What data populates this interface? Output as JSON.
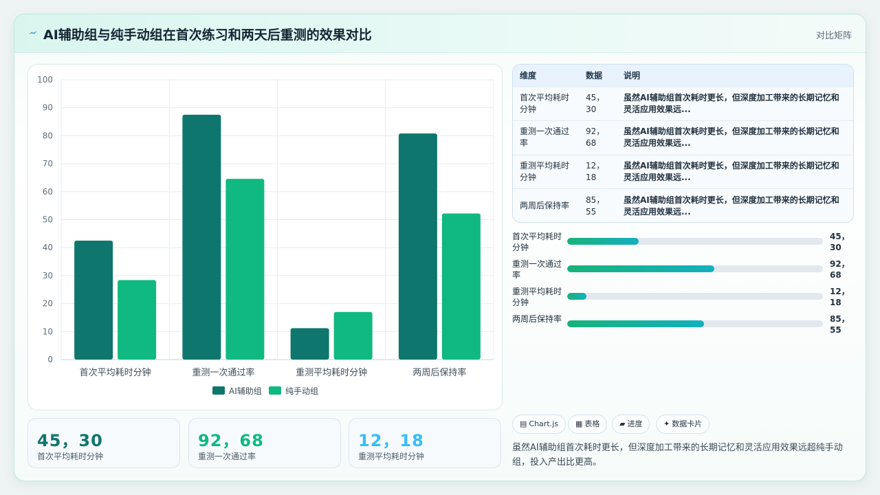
{
  "header": {
    "icon": "lightning-icon",
    "title": "AI辅助组与纯手动组在首次练习和两天后重测的效果对比",
    "badge": "对比矩阵"
  },
  "chart_data": {
    "type": "bar",
    "categories": [
      "首次平均耗时分钟",
      "重测一次通过率",
      "重测平均耗时分钟",
      "两周后保持率"
    ],
    "series": [
      {
        "name": "AI辅助组",
        "values": [
          42.5,
          87.5,
          11.2,
          80.8
        ],
        "color": "#0f766e"
      },
      {
        "name": "纯手动组",
        "values": [
          28.4,
          64.6,
          17.0,
          52.2
        ],
        "color": "#10b981"
      }
    ],
    "ylim": [
      0,
      100
    ],
    "yticks": [
      0,
      10,
      20,
      30,
      40,
      50,
      60,
      70,
      80,
      90,
      100
    ],
    "legend_position": "bottom",
    "grid": true
  },
  "table": {
    "headers": [
      "维度",
      "数据",
      "说明"
    ],
    "rows": [
      {
        "dim": "首次平均耗时分钟",
        "data": "45，30",
        "desc": "虽然AI辅助组首次耗时更长，但深度加工带来的长期记忆和灵活应用效果远..."
      },
      {
        "dim": "重测一次通过率",
        "data": "92，68",
        "desc": "虽然AI辅助组首次耗时更长，但深度加工带来的长期记忆和灵活应用效果远..."
      },
      {
        "dim": "重测平均耗时分钟",
        "data": "12，18",
        "desc": "虽然AI辅助组首次耗时更长，但深度加工带来的长期记忆和灵活应用效果远..."
      },
      {
        "dim": "两周后保持率",
        "data": "85，55",
        "desc": "虽然AI辅助组首次耗时更长，但深度加工带来的长期记忆和灵活应用效果远..."
      }
    ]
  },
  "progress": [
    {
      "label": "首次平均耗时分钟",
      "value": "45，30",
      "fraction": 0.28
    },
    {
      "label": "重测一次通过率",
      "value": "92，68",
      "fraction": 0.575
    },
    {
      "label": "重测平均耗时分钟",
      "value": "12，18",
      "fraction": 0.075
    },
    {
      "label": "两周后保持率",
      "value": "85，55",
      "fraction": 0.535
    }
  ],
  "stats": [
    {
      "value": "45，30",
      "label": "首次平均耗时分钟",
      "color": "#0f766e"
    },
    {
      "value": "92，68",
      "label": "重测一次通过率",
      "color": "#10b981"
    },
    {
      "value": "12，18",
      "label": "重测平均耗时分钟",
      "color": "#38bdf8"
    }
  ],
  "chips": [
    {
      "icon": "chart-icon",
      "glyph": "▤",
      "label": "Chart.js"
    },
    {
      "icon": "table-icon",
      "glyph": "▦",
      "label": "表格"
    },
    {
      "icon": "progress-icon",
      "glyph": "▰",
      "label": "进度"
    },
    {
      "icon": "sparkle-icon",
      "glyph": "✦",
      "label": "数据卡片"
    }
  ],
  "summary": "虽然AI辅助组首次耗时更长，但深度加工带来的长期记忆和灵活应用效果远超纯手动组，投入产出比更高。"
}
